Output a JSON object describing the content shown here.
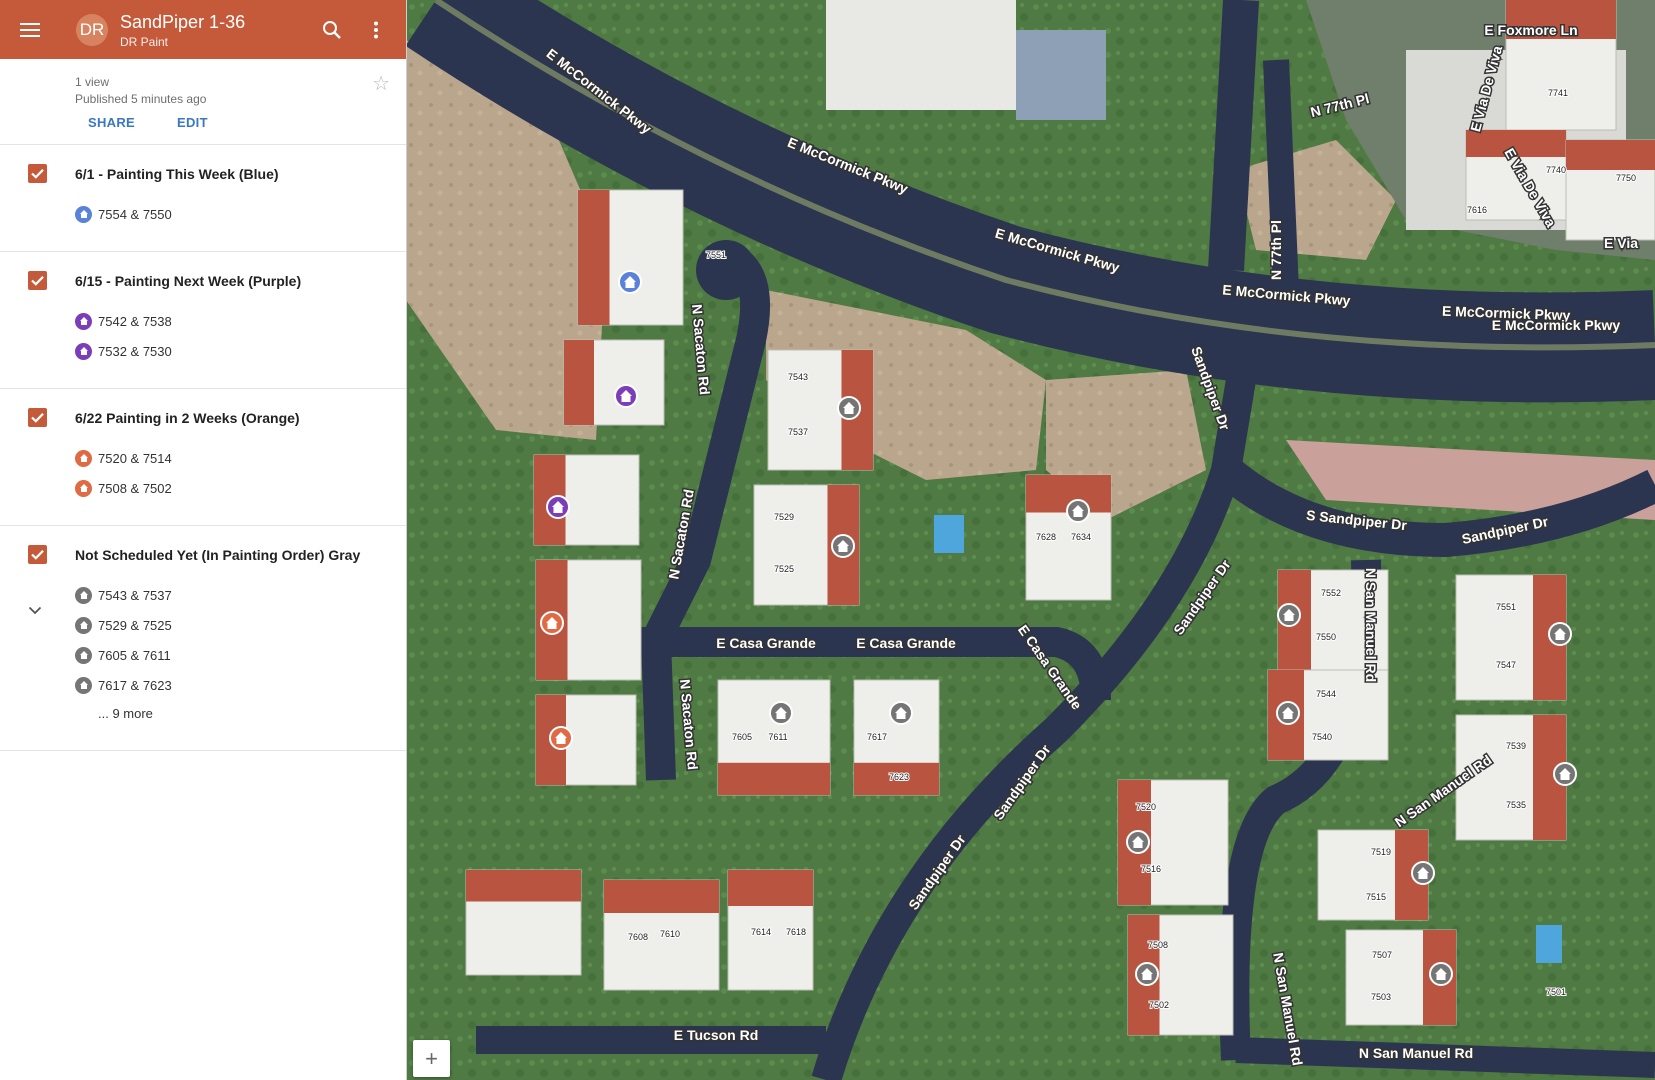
{
  "header": {
    "avatar_initials": "DR",
    "title": "SandPiper 1-36",
    "subtitle": "DR Paint",
    "menu_icon": "hamburger-menu-icon",
    "search_icon": "search-icon",
    "more_icon": "more-vert-icon",
    "brand_color": "#c55a3b"
  },
  "info": {
    "views": "1 view",
    "published": "Published 5 minutes ago",
    "share_label": "SHARE",
    "edit_label": "EDIT",
    "star_icon": "star-outline-icon"
  },
  "layers": [
    {
      "title": "6/1 - Painting This Week (Blue)",
      "color": "#5a82d8",
      "checked": true,
      "items": [
        "7554 & 7550"
      ]
    },
    {
      "title": "6/15 - Painting Next Week (Purple)",
      "color": "#7b3db8",
      "checked": true,
      "items": [
        "7542 & 7538",
        "7532 & 7530"
      ]
    },
    {
      "title": "6/22 Painting in 2 Weeks (Orange)",
      "color": "#e06a43",
      "checked": true,
      "items": [
        "7520 & 7514",
        "7508 & 7502"
      ]
    },
    {
      "title": "Not Scheduled Yet (In Painting Order) Gray",
      "color": "#757575",
      "checked": true,
      "items": [
        "7543 & 7537",
        "7529 & 7525",
        "7605 & 7611",
        "7617 & 7623"
      ],
      "more": "... 9 more"
    }
  ],
  "map": {
    "zoom_in_label": "+",
    "roads": [
      "E McCormick Pkwy",
      "E McCormick Pkwy",
      "E McCormick Pkwy",
      "E McCormick Pkwy",
      "E McCormick Pkwy",
      "E McCormick Pkwy",
      "N Sacaton Rd",
      "N Sacaton Rd",
      "N Sacaton Rd",
      "E Casa Grande",
      "E Casa Grande",
      "E Casa Grande",
      "Sandpiper Dr",
      "Sandpiper Dr",
      "Sandpiper Dr",
      "Sandpiper Dr",
      "S Sandpiper Dr",
      "Sandpiper Dr",
      "N San Manuel Rd",
      "N San Manuel Rd",
      "N San Manuel Rd",
      "N San Manuel Rd",
      "E Tucson Rd",
      "N 77th Pl",
      "N 77th Pl",
      "E Foxmore Ln",
      "E Via De Viva",
      "E Via De Viva",
      "E Via"
    ],
    "house_numbers": [
      "7551",
      "7543",
      "7537",
      "7529",
      "7525",
      "7628",
      "7634",
      "7605",
      "7611",
      "7617",
      "7623",
      "7608",
      "7610",
      "7614",
      "7618",
      "7552",
      "7550",
      "7551",
      "7547",
      "7544",
      "7540",
      "7539",
      "7535",
      "7520",
      "7516",
      "7519",
      "7515",
      "7508",
      "7502",
      "7507",
      "7503",
      "7501",
      "7741",
      "7740",
      "7750",
      "7616"
    ]
  }
}
